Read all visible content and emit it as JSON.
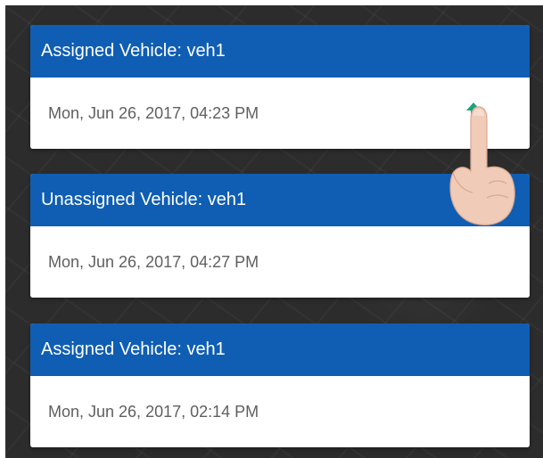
{
  "entries": [
    {
      "title": "Assigned Vehicle: veh1",
      "datetime": "Mon, Jun 26, 2017, 04:23 PM"
    },
    {
      "title": "Unassigned Vehicle: veh1",
      "datetime": "Mon, Jun 26, 2017, 04:27 PM"
    },
    {
      "title": "Assigned Vehicle: veh1",
      "datetime": "Mon, Jun 26, 2017, 02:14 PM"
    }
  ],
  "icons": {
    "sync_indicator": "arrow-up-icon",
    "gesture": "tap-hand-icon"
  },
  "colors": {
    "header_bg": "#0f5eb3",
    "header_text": "#ffffff",
    "body_bg": "#ffffff",
    "body_text": "#5f5f5f",
    "arrow": "#1aa37a",
    "background": "#2c2c2c"
  }
}
